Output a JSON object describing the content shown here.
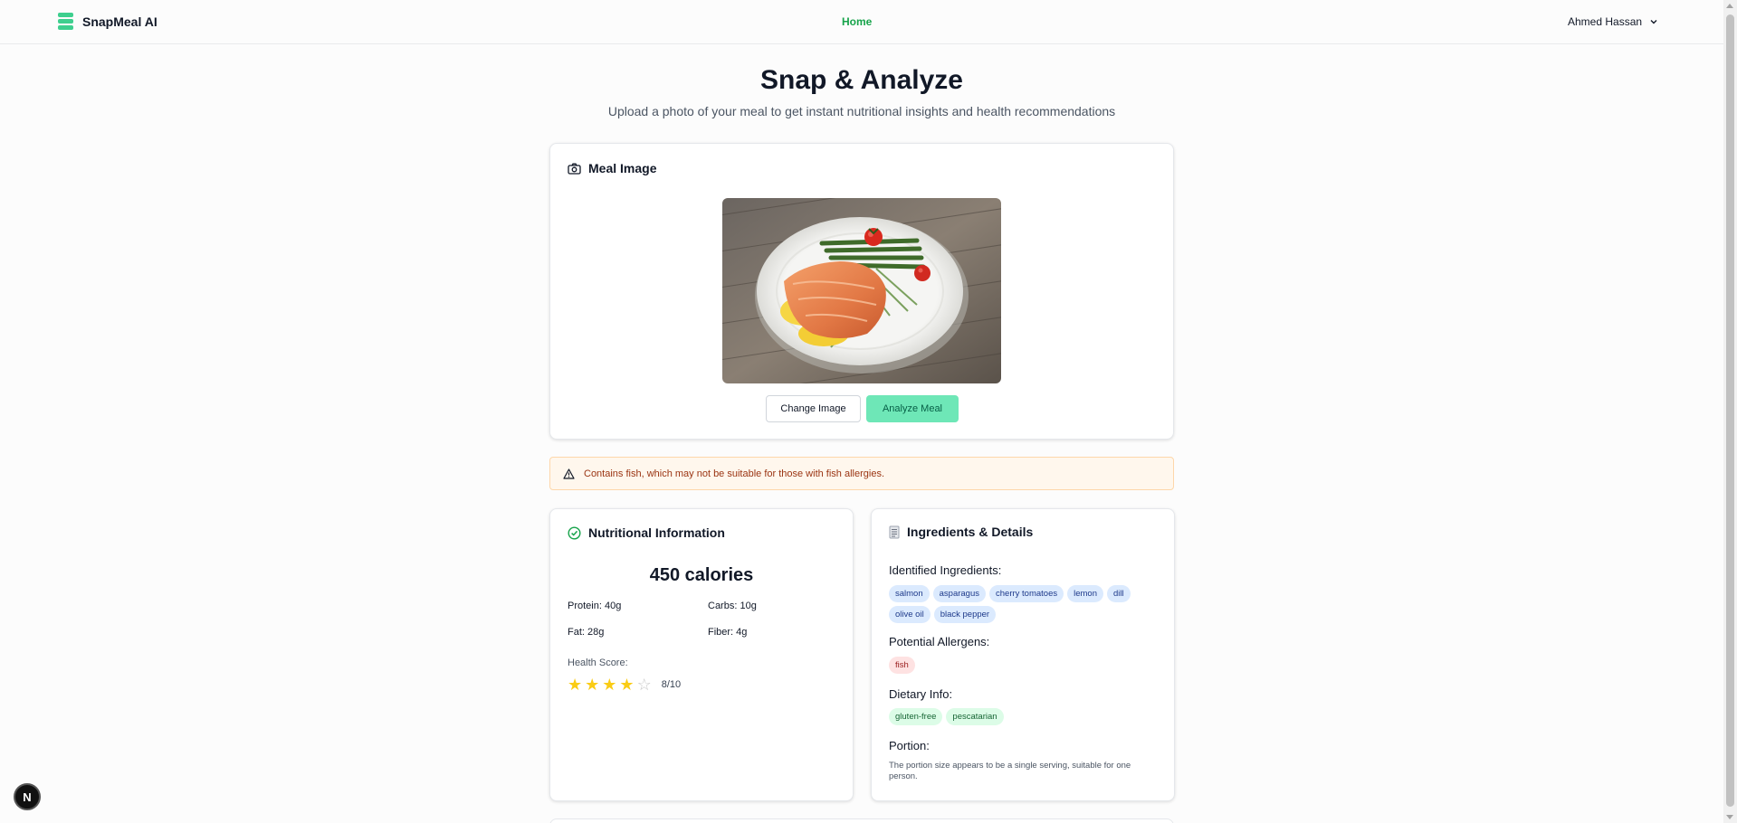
{
  "app": {
    "name": "SnapMeal AI"
  },
  "nav": {
    "home_label": "Home"
  },
  "user": {
    "name": "Ahmed Hassan"
  },
  "page": {
    "title": "Snap & Analyze",
    "subtitle": "Upload a photo of your meal to get instant nutritional insights and health recommendations"
  },
  "meal_image": {
    "header": "Meal Image",
    "change_label": "Change Image",
    "analyze_label": "Analyze Meal"
  },
  "warning": {
    "text": "Contains fish, which may not be suitable for those with fish allergies."
  },
  "nutrition": {
    "header": "Nutritional Information",
    "calories": "450 calories",
    "protein": "Protein: 40g",
    "carbs": "Carbs: 10g",
    "fat": "Fat: 28g",
    "fiber": "Fiber: 4g",
    "health_score_label": "Health Score:",
    "health_score_text": "8/10",
    "stars_filled": 4,
    "stars_total": 5
  },
  "ingredients": {
    "header": "Ingredients & Details",
    "identified_label": "Identified Ingredients:",
    "identified": [
      "salmon",
      "asparagus",
      "cherry tomatoes",
      "lemon",
      "dill",
      "olive oil",
      "black pepper"
    ],
    "allergens_label": "Potential Allergens:",
    "allergens": [
      "fish"
    ],
    "dietary_label": "Dietary Info:",
    "dietary": [
      "gluten-free",
      "pescatarian"
    ],
    "portion_label": "Portion:",
    "portion_text": "The portion size appears to be a single serving, suitable for one person."
  },
  "dev_badge": {
    "letter": "N"
  },
  "colors": {
    "accent": "#3ecf8e",
    "nav_active": "#16a34a",
    "warning_text": "#9a3412",
    "star": "#facc15"
  }
}
